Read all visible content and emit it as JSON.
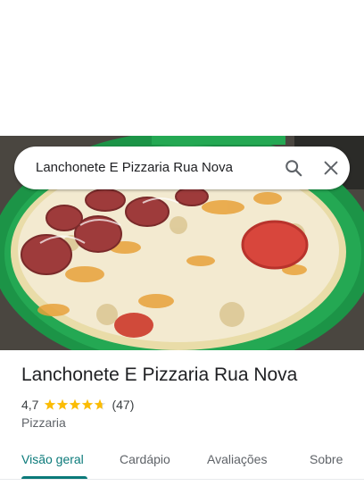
{
  "search": {
    "query": "Lanchonete E Pizzaria Rua Nova"
  },
  "place": {
    "name": "Lanchonete E Pizzaria Rua Nova",
    "rating": "4,7",
    "rating_value": 4.7,
    "review_count": "(47)",
    "category": "Pizzaria"
  },
  "tabs": [
    {
      "label": "Visão geral",
      "active": true
    },
    {
      "label": "Cardápio",
      "active": false
    },
    {
      "label": "Avaliações",
      "active": false
    },
    {
      "label": "Sobre",
      "active": false
    }
  ],
  "colors": {
    "accent": "#0b7a7a",
    "star": "#fbbc04",
    "tray": "#1f9a4a"
  },
  "icons": [
    "search-icon",
    "close-icon",
    "star-icon"
  ]
}
